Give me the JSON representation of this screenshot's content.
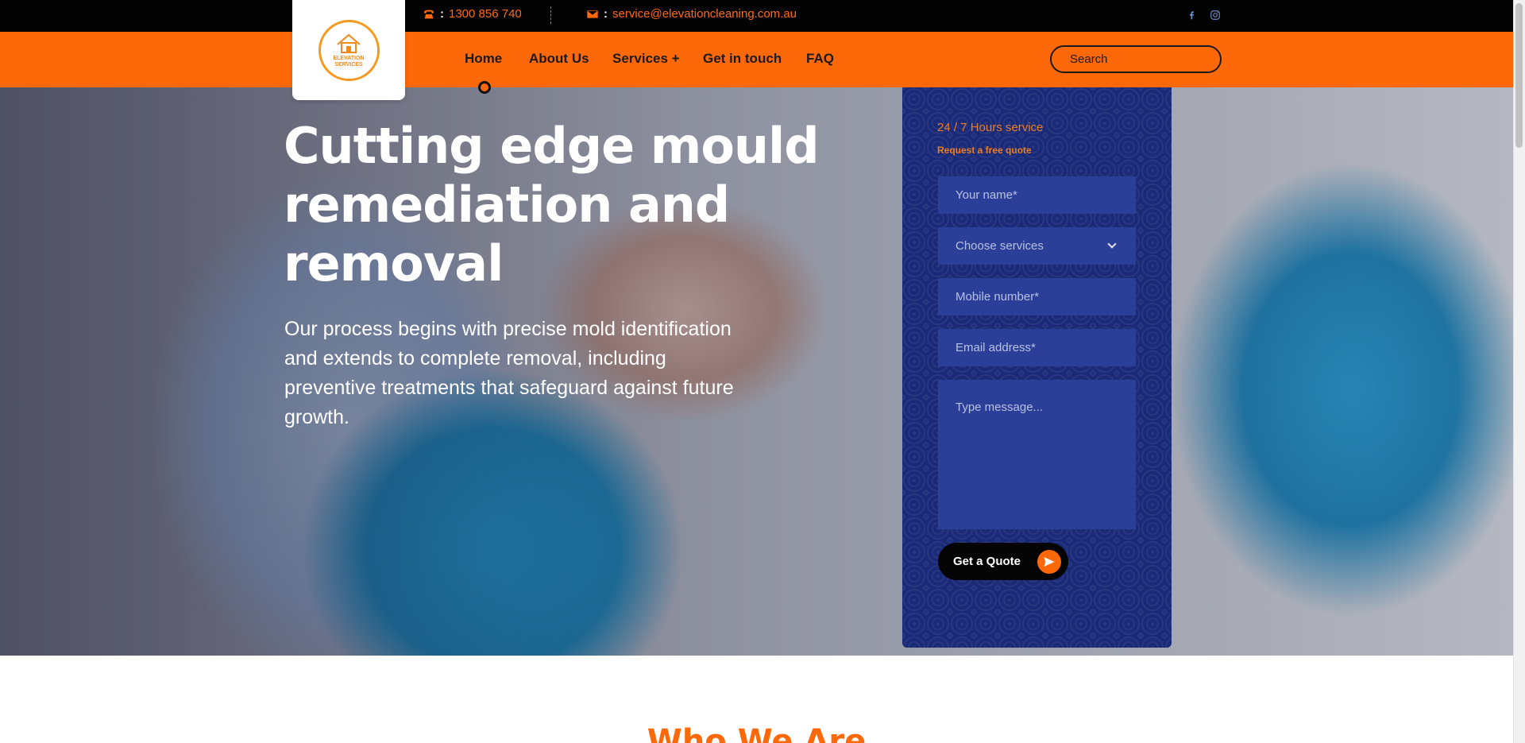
{
  "topbar": {
    "phone": "1300 856 740",
    "email": "service@elevationcleaning.com.au",
    "separator": ":"
  },
  "logo": {
    "line1": "ELEVATION",
    "line2": "SERVICES"
  },
  "nav": {
    "items": [
      {
        "label": "Home"
      },
      {
        "label": "About Us"
      },
      {
        "label": "Services +"
      },
      {
        "label": "Get in touch"
      },
      {
        "label": "FAQ"
      }
    ],
    "search_placeholder": "Search"
  },
  "hero": {
    "title": "Cutting edge mould remediation and removal",
    "subtitle": "Our process begins with precise mold identification and extends to complete removal, including preventive treatments that safeguard against future growth."
  },
  "quote_form": {
    "service_hours": "24 / 7 Hours service",
    "heading": "Request a free quote",
    "name_placeholder": "Your name*",
    "service_select": "Choose services",
    "mobile_placeholder": "Mobile number*",
    "email_placeholder": "Email address*",
    "message_placeholder": "Type message...",
    "submit_label": "Get a Quote"
  },
  "sections": {
    "who_we_are": "Who We Are"
  },
  "colors": {
    "accent": "#fd6908",
    "topbar_bg": "#030303",
    "form_bg": "#1a2a78",
    "field_bg": "#2b3f98"
  },
  "icons": {
    "phone": "phone-icon",
    "email": "envelope-icon",
    "facebook": "facebook-icon",
    "instagram": "instagram-icon",
    "arrow": "send-arrow-icon"
  }
}
